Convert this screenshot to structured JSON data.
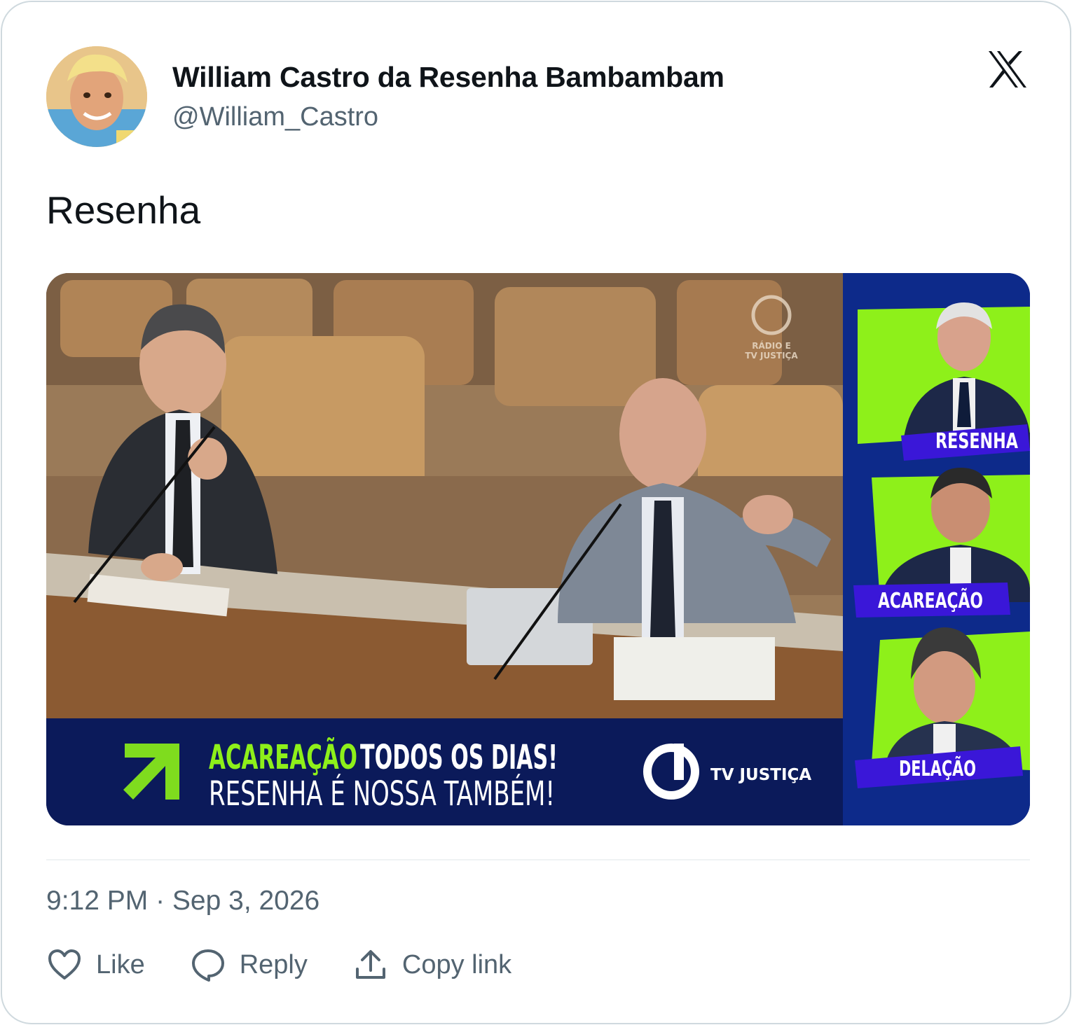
{
  "author": {
    "name": "William Castro da Resenha Bambambam",
    "handle": "@William_Castro",
    "avatar_icon": "user-avatar"
  },
  "brand_icon": "x-logo-icon",
  "tweet": {
    "text": "Resenha",
    "timestamp": "9:12 PM · Sep 3, 2026"
  },
  "media": {
    "banner_line1_highlight": "ACAREAÇÃO",
    "banner_line1_rest": " TODOS OS DIAS!",
    "banner_line2": "RESENHA É NOSSA TAMBÉM!",
    "channel": "TV JUSTIÇA",
    "watermark_line1": "RÁDIO E",
    "watermark_line2": "TV JUSTIÇA",
    "side_panels": [
      {
        "label": "RESENHA"
      },
      {
        "label": "ACAREAÇÃO"
      },
      {
        "label": "DELAÇÃO"
      }
    ],
    "colors": {
      "navy": "#0b1a5a",
      "accent_green": "#8ef01a",
      "label_purple": "#3a17d8"
    }
  },
  "actions": {
    "like": {
      "label": "Like",
      "icon": "heart-icon"
    },
    "reply": {
      "label": "Reply",
      "icon": "reply-bubble-icon"
    },
    "copy": {
      "label": "Copy link",
      "icon": "share-upload-icon"
    }
  }
}
